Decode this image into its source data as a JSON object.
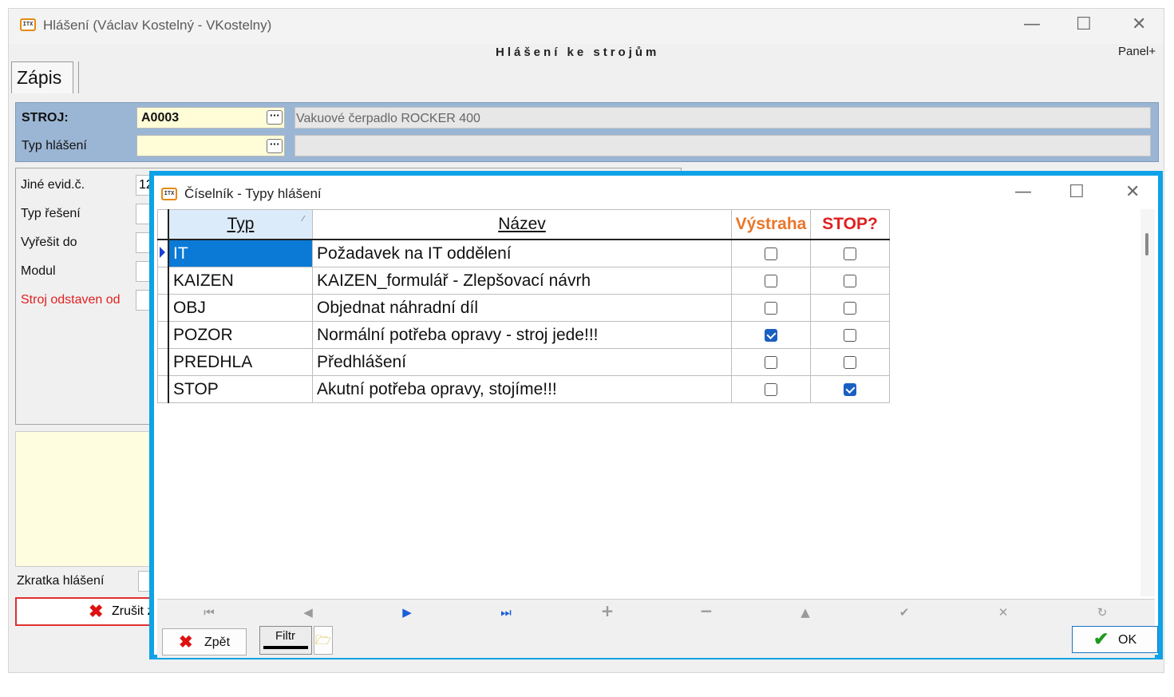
{
  "main_window": {
    "title": "Hlášení (Václav Kostelný - VKostelny)",
    "icon": "app-logo-icon",
    "minimize": "—",
    "maximize": "☐",
    "close": "✕"
  },
  "header": {
    "title": "Hlášení ke strojům",
    "panel_plus": "Panel+"
  },
  "tabs": [
    {
      "label": "Zápis"
    }
  ],
  "form": {
    "stroj_label": "STROJ:",
    "stroj_value": "A0003",
    "stroj_desc": "Vakuové čerpadlo ROCKER 400",
    "typ_label": "Typ hlášení",
    "typ_value": "",
    "typ_desc": ""
  },
  "left_panel": {
    "jine_evid": "Jiné evid.č.",
    "jine_evid_value": "12",
    "typ_reseni": "Typ řešení",
    "vyresit_do": "Vyřešit do",
    "modul": "Modul",
    "stroj_odstaven": "Stroj odstaven od",
    "zkratka": "Zkratka hlášení",
    "zrusit": "Zrušit z"
  },
  "colors": {
    "accent": "#0ea2e7",
    "selected_row": "#0a7ad6",
    "warning": "#e9762a",
    "stop": "#e02020",
    "danger": "#e03030"
  },
  "dialog": {
    "title": "Číselník - Typy hlášení",
    "minimize": "—",
    "maximize": "☐",
    "close": "✕",
    "columns": {
      "typ": "Typ",
      "nazev": "Název",
      "vystraha": "Výstraha",
      "stop": "STOP?"
    },
    "rows": [
      {
        "typ": "IT",
        "nazev": "Požadavek na IT oddělení",
        "vystraha": false,
        "stop": false
      },
      {
        "typ": "KAIZEN",
        "nazev": "KAIZEN_formulář - Zlepšovací návrh",
        "vystraha": false,
        "stop": false
      },
      {
        "typ": "OBJ",
        "nazev": "Objednat náhradní díl",
        "vystraha": false,
        "stop": false
      },
      {
        "typ": "POZOR",
        "nazev": "Normální potřeba opravy - stroj jede!!!",
        "vystraha": true,
        "stop": false
      },
      {
        "typ": "PREDHLA",
        "nazev": "Předhlášení",
        "vystraha": false,
        "stop": false
      },
      {
        "typ": "STOP",
        "nazev": "Akutní potřeba opravy, stojíme!!!",
        "vystraha": false,
        "stop": true
      }
    ],
    "nav": [
      "⏮",
      "◀",
      "▶",
      "⏭",
      "+",
      "−",
      "▲",
      "✔",
      "✕",
      "↻"
    ],
    "zpet": "Zpět",
    "filtr": "Filtr",
    "ok": "OK"
  }
}
